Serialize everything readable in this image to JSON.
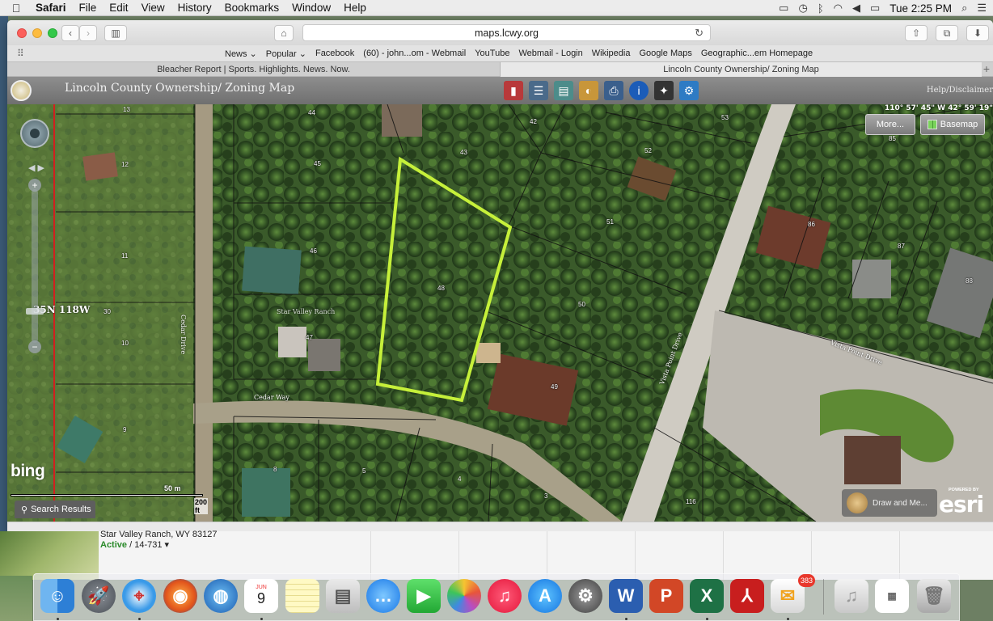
{
  "menubar": {
    "apple": "",
    "app_name": "Safari",
    "items": [
      "File",
      "Edit",
      "View",
      "History",
      "Bookmarks",
      "Window",
      "Help"
    ],
    "clock": "Tue 2:25 PM"
  },
  "browser": {
    "url": "maps.lcwy.org",
    "favorites": [
      "News ⌄",
      "Popular ⌄",
      "Facebook",
      "(60) - john...om - Webmail",
      "YouTube",
      "Webmail - Login",
      "Wikipedia",
      "Google Maps",
      "Geographic...em Homepage"
    ],
    "tabs": [
      {
        "label": "Bleacher Report | Sports. Highlights. News. Now.",
        "active": false
      },
      {
        "label": "Lincoln County Ownership/ Zoning Map",
        "active": true
      }
    ]
  },
  "map_app": {
    "title": "Lincoln County Ownership/ Zoning Map",
    "help_link": "Help/Disclaimer",
    "coordinates": "110° 57' 45\" W 42° 59' 19\"",
    "more_button": "More...",
    "basemap_button": "Basemap",
    "township_label": "35N 118W",
    "bing_logo": "bing",
    "scale_m": "50 m",
    "scale_ft": "200 ft",
    "search_results": "Search Results",
    "draw_menu": "Draw and Me...",
    "esri_powered": "POWERED BY",
    "esri_logo": "esri",
    "parcel_numbers": [
      "13",
      "12",
      "11",
      "10",
      "9",
      "30",
      "44",
      "45",
      "46",
      "47",
      "48",
      "43",
      "42",
      "52",
      "53",
      "51",
      "50",
      "49",
      "8",
      "5",
      "4",
      "3",
      "116",
      "85",
      "86",
      "87",
      "88"
    ],
    "road_labels": [
      "Cedar Drive",
      "Cedar Way",
      "Star Valley Ranch",
      "Vista Point Drive",
      "Vista Point Drive"
    ]
  },
  "behind_window": {
    "address": "Star Valley Ranch, WY 83127",
    "status": "Active",
    "listing_id": "/ 14-731"
  },
  "dock": {
    "calendar_month": "JUN",
    "calendar_day": "9",
    "mail_badge": "383"
  },
  "colors": {
    "selection_outline": "#c6f03a",
    "map_header": "#7e7e7e"
  }
}
